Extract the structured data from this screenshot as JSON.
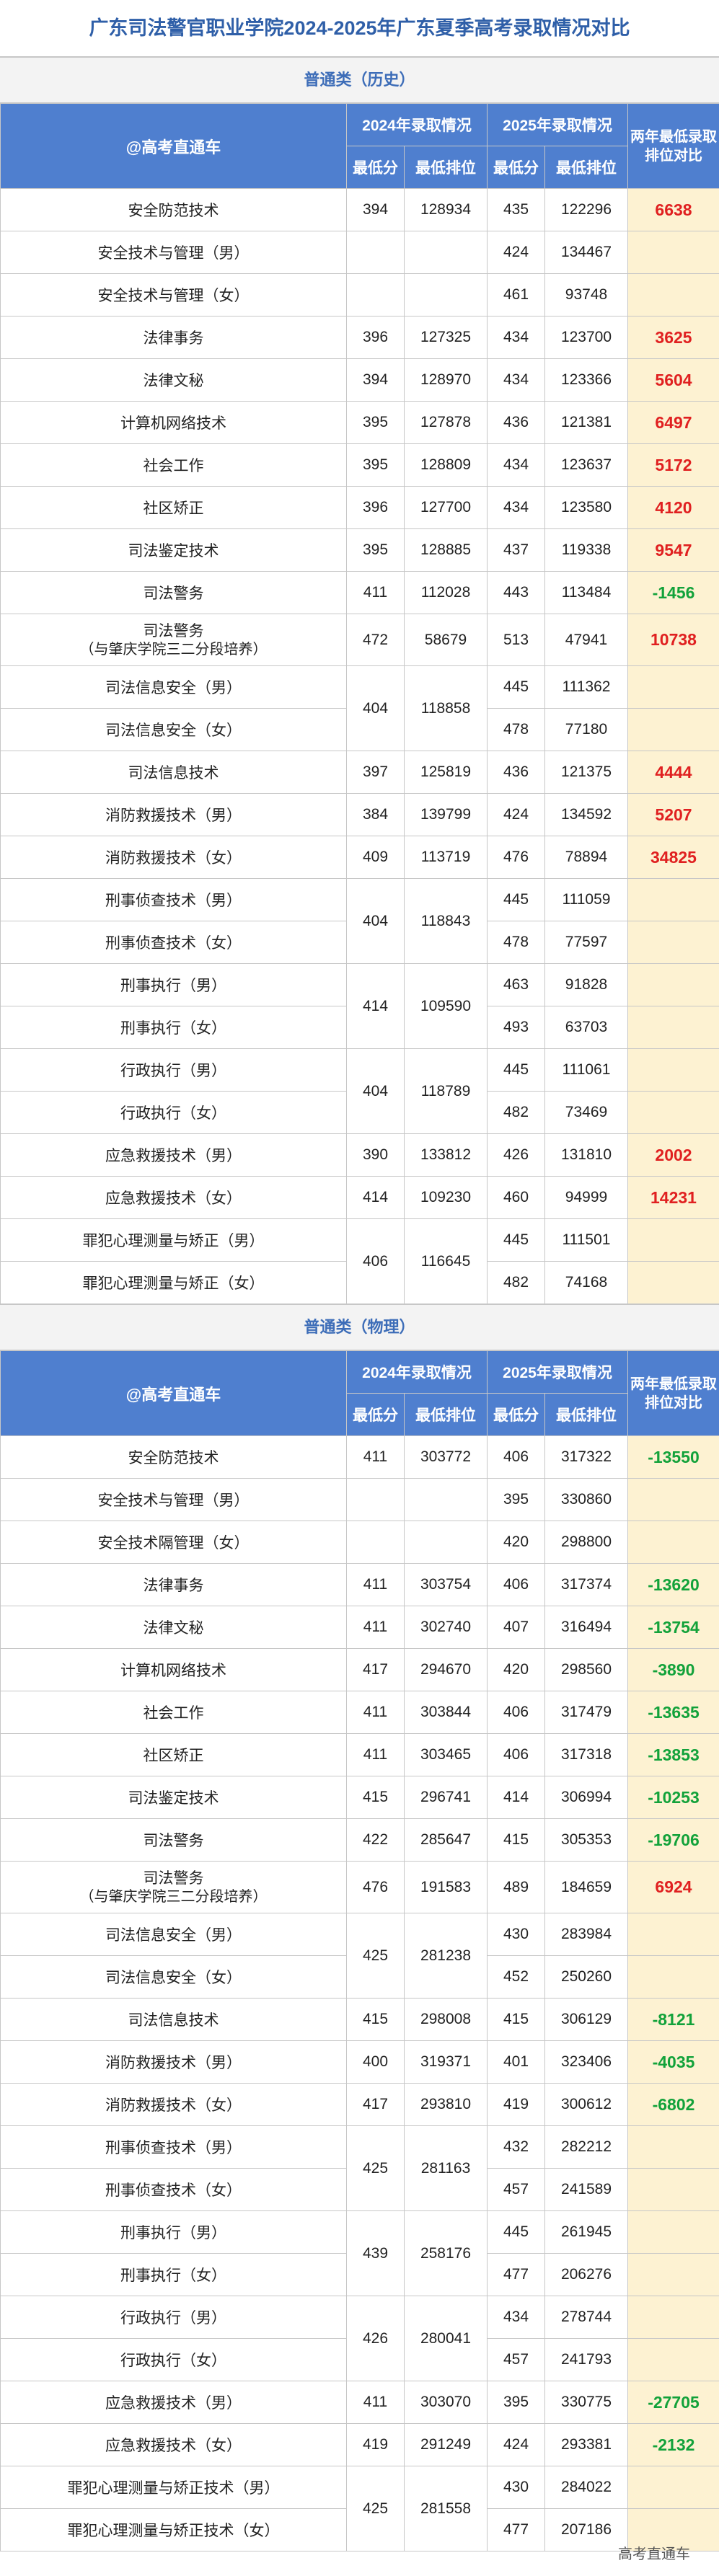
{
  "title": "广东司法警官职业学院2024-2025年广东夏季高考录取情况对比",
  "header": {
    "corner": "@高考直通车",
    "y2024": "2024年录取情况",
    "y2025": "2025年录取情况",
    "diff": "两年最低录取排位对比",
    "min_score": "最低分",
    "min_rank": "最低排位"
  },
  "sections": [
    {
      "title": "普通类（历史）",
      "rows": [
        {
          "major": "安全防范技术",
          "s24": "394",
          "r24": "128934",
          "s25": "435",
          "r25": "122296",
          "diff": "6638",
          "sign": "pos"
        },
        {
          "major": "安全技术与管理（男）",
          "s24": "",
          "r24": "",
          "s25": "424",
          "r25": "134467",
          "diff": "",
          "sign": ""
        },
        {
          "major": "安全技术与管理（女）",
          "s24": "",
          "r24": "",
          "s25": "461",
          "r25": "93748",
          "diff": "",
          "sign": ""
        },
        {
          "major": "法律事务",
          "s24": "396",
          "r24": "127325",
          "s25": "434",
          "r25": "123700",
          "diff": "3625",
          "sign": "pos"
        },
        {
          "major": "法律文秘",
          "s24": "394",
          "r24": "128970",
          "s25": "434",
          "r25": "123366",
          "diff": "5604",
          "sign": "pos"
        },
        {
          "major": "计算机网络技术",
          "s24": "395",
          "r24": "127878",
          "s25": "436",
          "r25": "121381",
          "diff": "6497",
          "sign": "pos"
        },
        {
          "major": "社会工作",
          "s24": "395",
          "r24": "128809",
          "s25": "434",
          "r25": "123637",
          "diff": "5172",
          "sign": "pos"
        },
        {
          "major": "社区矫正",
          "s24": "396",
          "r24": "127700",
          "s25": "434",
          "r25": "123580",
          "diff": "4120",
          "sign": "pos"
        },
        {
          "major": "司法鉴定技术",
          "s24": "395",
          "r24": "128885",
          "s25": "437",
          "r25": "119338",
          "diff": "9547",
          "sign": "pos"
        },
        {
          "major": "司法警务",
          "s24": "411",
          "r24": "112028",
          "s25": "443",
          "r25": "113484",
          "diff": "-1456",
          "sign": "neg"
        },
        {
          "major": "司法警务",
          "major2": "（与肇庆学院三二分段培养）",
          "s24": "472",
          "r24": "58679",
          "s25": "513",
          "r25": "47941",
          "diff": "10738",
          "sign": "pos",
          "tall": true
        },
        {
          "major": "司法信息安全（男）",
          "s24": "404",
          "r24": "118858",
          "span": 2,
          "s25": "445",
          "r25": "111362",
          "diff": "",
          "sign": ""
        },
        {
          "major": "司法信息安全（女）",
          "s25": "478",
          "r25": "77180",
          "diff": "",
          "sign": "",
          "spanned": true
        },
        {
          "major": "司法信息技术",
          "s24": "397",
          "r24": "125819",
          "s25": "436",
          "r25": "121375",
          "diff": "4444",
          "sign": "pos"
        },
        {
          "major": "消防救援技术（男）",
          "s24": "384",
          "r24": "139799",
          "s25": "424",
          "r25": "134592",
          "diff": "5207",
          "sign": "pos"
        },
        {
          "major": "消防救援技术（女）",
          "s24": "409",
          "r24": "113719",
          "s25": "476",
          "r25": "78894",
          "diff": "34825",
          "sign": "pos"
        },
        {
          "major": "刑事侦查技术（男）",
          "s24": "404",
          "r24": "118843",
          "span": 2,
          "s25": "445",
          "r25": "111059",
          "diff": "",
          "sign": ""
        },
        {
          "major": "刑事侦查技术（女）",
          "s25": "478",
          "r25": "77597",
          "diff": "",
          "sign": "",
          "spanned": true
        },
        {
          "major": "刑事执行（男）",
          "s24": "414",
          "r24": "109590",
          "span": 2,
          "s25": "463",
          "r25": "91828",
          "diff": "",
          "sign": ""
        },
        {
          "major": "刑事执行（女）",
          "s25": "493",
          "r25": "63703",
          "diff": "",
          "sign": "",
          "spanned": true
        },
        {
          "major": "行政执行（男）",
          "s24": "404",
          "r24": "118789",
          "span": 2,
          "s25": "445",
          "r25": "111061",
          "diff": "",
          "sign": ""
        },
        {
          "major": "行政执行（女）",
          "s25": "482",
          "r25": "73469",
          "diff": "",
          "sign": "",
          "spanned": true
        },
        {
          "major": "应急救援技术（男）",
          "s24": "390",
          "r24": "133812",
          "s25": "426",
          "r25": "131810",
          "diff": "2002",
          "sign": "pos"
        },
        {
          "major": "应急救援技术（女）",
          "s24": "414",
          "r24": "109230",
          "s25": "460",
          "r25": "94999",
          "diff": "14231",
          "sign": "pos"
        },
        {
          "major": "罪犯心理测量与矫正（男）",
          "s24": "406",
          "r24": "116645",
          "span": 2,
          "s25": "445",
          "r25": "111501",
          "diff": "",
          "sign": ""
        },
        {
          "major": "罪犯心理测量与矫正（女）",
          "s25": "482",
          "r25": "74168",
          "diff": "",
          "sign": "",
          "spanned": true
        }
      ]
    },
    {
      "title": "普通类（物理）",
      "rows": [
        {
          "major": "安全防范技术",
          "s24": "411",
          "r24": "303772",
          "s25": "406",
          "r25": "317322",
          "diff": "-13550",
          "sign": "neg"
        },
        {
          "major": "安全技术与管理（男）",
          "s24": "",
          "r24": "",
          "s25": "395",
          "r25": "330860",
          "diff": "",
          "sign": ""
        },
        {
          "major": "安全技术隔管理（女）",
          "s24": "",
          "r24": "",
          "s25": "420",
          "r25": "298800",
          "diff": "",
          "sign": ""
        },
        {
          "major": "法律事务",
          "s24": "411",
          "r24": "303754",
          "s25": "406",
          "r25": "317374",
          "diff": "-13620",
          "sign": "neg"
        },
        {
          "major": "法律文秘",
          "s24": "411",
          "r24": "302740",
          "s25": "407",
          "r25": "316494",
          "diff": "-13754",
          "sign": "neg"
        },
        {
          "major": "计算机网络技术",
          "s24": "417",
          "r24": "294670",
          "s25": "420",
          "r25": "298560",
          "diff": "-3890",
          "sign": "neg"
        },
        {
          "major": "社会工作",
          "s24": "411",
          "r24": "303844",
          "s25": "406",
          "r25": "317479",
          "diff": "-13635",
          "sign": "neg"
        },
        {
          "major": "社区矫正",
          "s24": "411",
          "r24": "303465",
          "s25": "406",
          "r25": "317318",
          "diff": "-13853",
          "sign": "neg"
        },
        {
          "major": "司法鉴定技术",
          "s24": "415",
          "r24": "296741",
          "s25": "414",
          "r25": "306994",
          "diff": "-10253",
          "sign": "neg"
        },
        {
          "major": "司法警务",
          "s24": "422",
          "r24": "285647",
          "s25": "415",
          "r25": "305353",
          "diff": "-19706",
          "sign": "neg"
        },
        {
          "major": "司法警务",
          "major2": "（与肇庆学院三二分段培养）",
          "s24": "476",
          "r24": "191583",
          "s25": "489",
          "r25": "184659",
          "diff": "6924",
          "sign": "pos",
          "tall": true
        },
        {
          "major": "司法信息安全（男）",
          "s24": "425",
          "r24": "281238",
          "span": 2,
          "s25": "430",
          "r25": "283984",
          "diff": "",
          "sign": ""
        },
        {
          "major": "司法信息安全（女）",
          "s25": "452",
          "r25": "250260",
          "diff": "",
          "sign": "",
          "spanned": true
        },
        {
          "major": "司法信息技术",
          "s24": "415",
          "r24": "298008",
          "s25": "415",
          "r25": "306129",
          "diff": "-8121",
          "sign": "neg"
        },
        {
          "major": "消防救援技术（男）",
          "s24": "400",
          "r24": "319371",
          "s25": "401",
          "r25": "323406",
          "diff": "-4035",
          "sign": "neg"
        },
        {
          "major": "消防救援技术（女）",
          "s24": "417",
          "r24": "293810",
          "s25": "419",
          "r25": "300612",
          "diff": "-6802",
          "sign": "neg"
        },
        {
          "major": "刑事侦查技术（男）",
          "s24": "425",
          "r24": "281163",
          "span": 2,
          "s25": "432",
          "r25": "282212",
          "diff": "",
          "sign": ""
        },
        {
          "major": "刑事侦查技术（女）",
          "s25": "457",
          "r25": "241589",
          "diff": "",
          "sign": "",
          "spanned": true
        },
        {
          "major": "刑事执行（男）",
          "s24": "439",
          "r24": "258176",
          "span": 2,
          "s25": "445",
          "r25": "261945",
          "diff": "",
          "sign": ""
        },
        {
          "major": "刑事执行（女）",
          "s25": "477",
          "r25": "206276",
          "diff": "",
          "sign": "",
          "spanned": true
        },
        {
          "major": "行政执行（男）",
          "s24": "426",
          "r24": "280041",
          "span": 2,
          "s25": "434",
          "r25": "278744",
          "diff": "",
          "sign": ""
        },
        {
          "major": "行政执行（女）",
          "s25": "457",
          "r25": "241793",
          "diff": "",
          "sign": "",
          "spanned": true
        },
        {
          "major": "应急救援技术（男）",
          "s24": "411",
          "r24": "303070",
          "s25": "395",
          "r25": "330775",
          "diff": "-27705",
          "sign": "neg"
        },
        {
          "major": "应急救援技术（女）",
          "s24": "419",
          "r24": "291249",
          "s25": "424",
          "r25": "293381",
          "diff": "-2132",
          "sign": "neg"
        },
        {
          "major": "罪犯心理测量与矫正技术（男）",
          "s24": "425",
          "r24": "281558",
          "span": 2,
          "s25": "430",
          "r25": "284022",
          "diff": "",
          "sign": ""
        },
        {
          "major": "罪犯心理测量与矫正技术（女）",
          "s25": "477",
          "r25": "207186",
          "diff": "",
          "sign": "",
          "spanned": true
        }
      ]
    }
  ],
  "watermark": "高考直通车"
}
